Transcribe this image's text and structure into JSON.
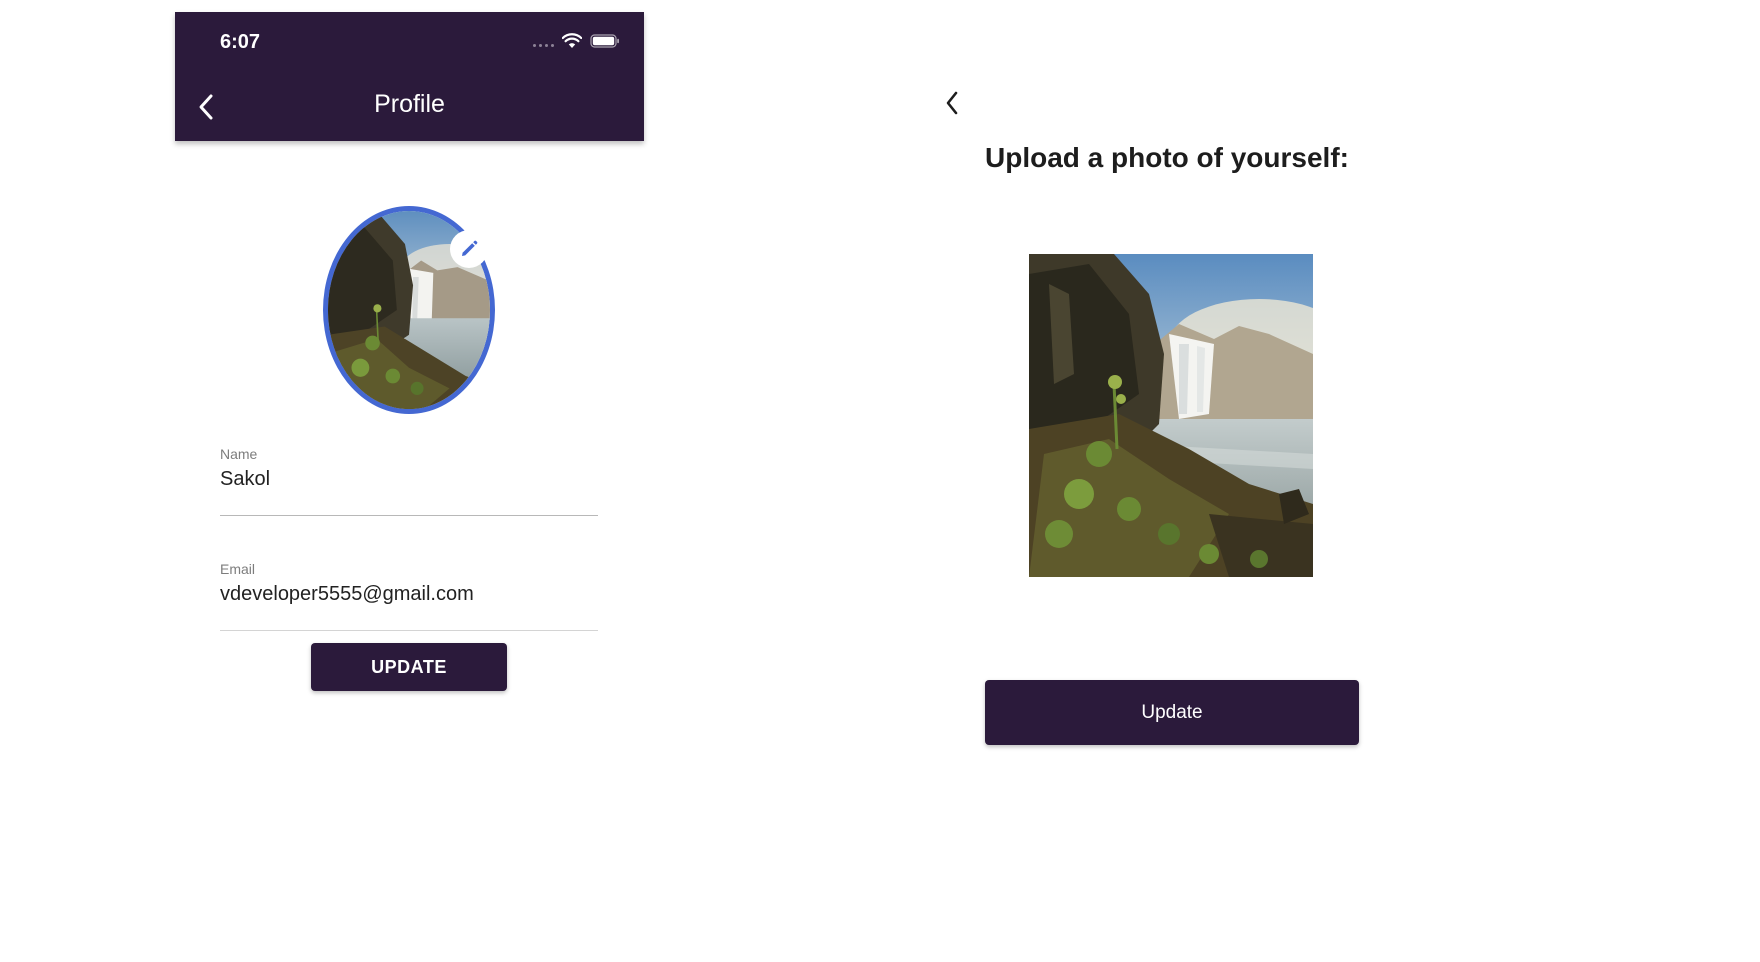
{
  "colors": {
    "primary": "#2b1a3b",
    "accent": "#4468d2",
    "text": "#1f1f1f",
    "label": "#7d7d7d",
    "divider": "#b8b8b8"
  },
  "profile_screen": {
    "status_bar": {
      "time": "6:07",
      "icons": [
        "signal-dots-icon",
        "wifi-icon",
        "battery-icon"
      ]
    },
    "appbar": {
      "back_icon": "chevron-left-icon",
      "title": "Profile"
    },
    "avatar": {
      "image": "waterfall-landscape-photo",
      "edit_icon": "pencil-icon"
    },
    "fields": {
      "name": {
        "label": "Name",
        "value": "Sakol"
      },
      "email": {
        "label": "Email",
        "value": "vdeveloper5555@gmail.com"
      }
    },
    "update_button": "UPDATE"
  },
  "upload_screen": {
    "back_icon": "chevron-left-icon",
    "title": "Upload a photo of yourself:",
    "photo": "waterfall-landscape-photo",
    "update_button": "Update"
  }
}
